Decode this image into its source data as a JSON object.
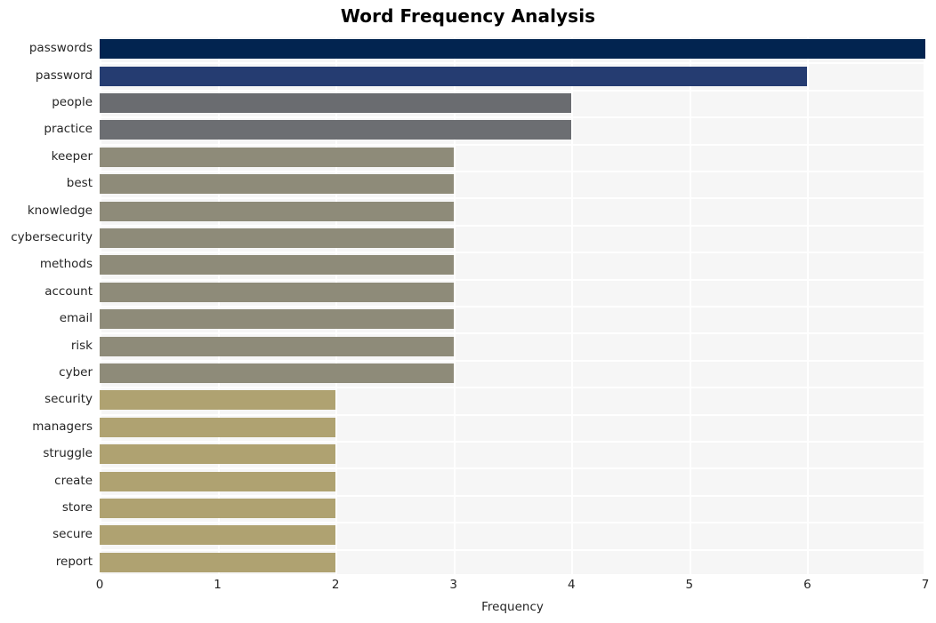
{
  "chart_data": {
    "type": "bar",
    "orientation": "horizontal",
    "title": "Word Frequency Analysis",
    "xlabel": "Frequency",
    "ylabel": "",
    "xlim": [
      0,
      7
    ],
    "xticks": [
      0,
      1,
      2,
      3,
      4,
      5,
      6,
      7
    ],
    "xtick_labels": [
      "0",
      "1",
      "2",
      "3",
      "4",
      "5",
      "6",
      "7"
    ],
    "grid": true,
    "grid_color": "#ffffff",
    "plot_background": "#f6f6f6",
    "figure_background": "#ffffff",
    "legend": null,
    "categories": [
      "passwords",
      "password",
      "people",
      "practice",
      "keeper",
      "best",
      "knowledge",
      "cybersecurity",
      "methods",
      "account",
      "email",
      "risk",
      "cyber",
      "security",
      "managers",
      "struggle",
      "create",
      "store",
      "secure",
      "report"
    ],
    "values": [
      7,
      6,
      4,
      4,
      3,
      3,
      3,
      3,
      3,
      3,
      3,
      3,
      3,
      2,
      2,
      2,
      2,
      2,
      2,
      2
    ],
    "bar_colors": [
      "#022450",
      "#253c71",
      "#6a6c70",
      "#6c6e72",
      "#8e8b79",
      "#8e8b79",
      "#8e8b79",
      "#8e8b79",
      "#8e8b79",
      "#8e8b79",
      "#8e8b79",
      "#8e8b79",
      "#8e8b79",
      "#afa271",
      "#afa271",
      "#afa271",
      "#afa271",
      "#afa271",
      "#afa271",
      "#afa271"
    ]
  }
}
